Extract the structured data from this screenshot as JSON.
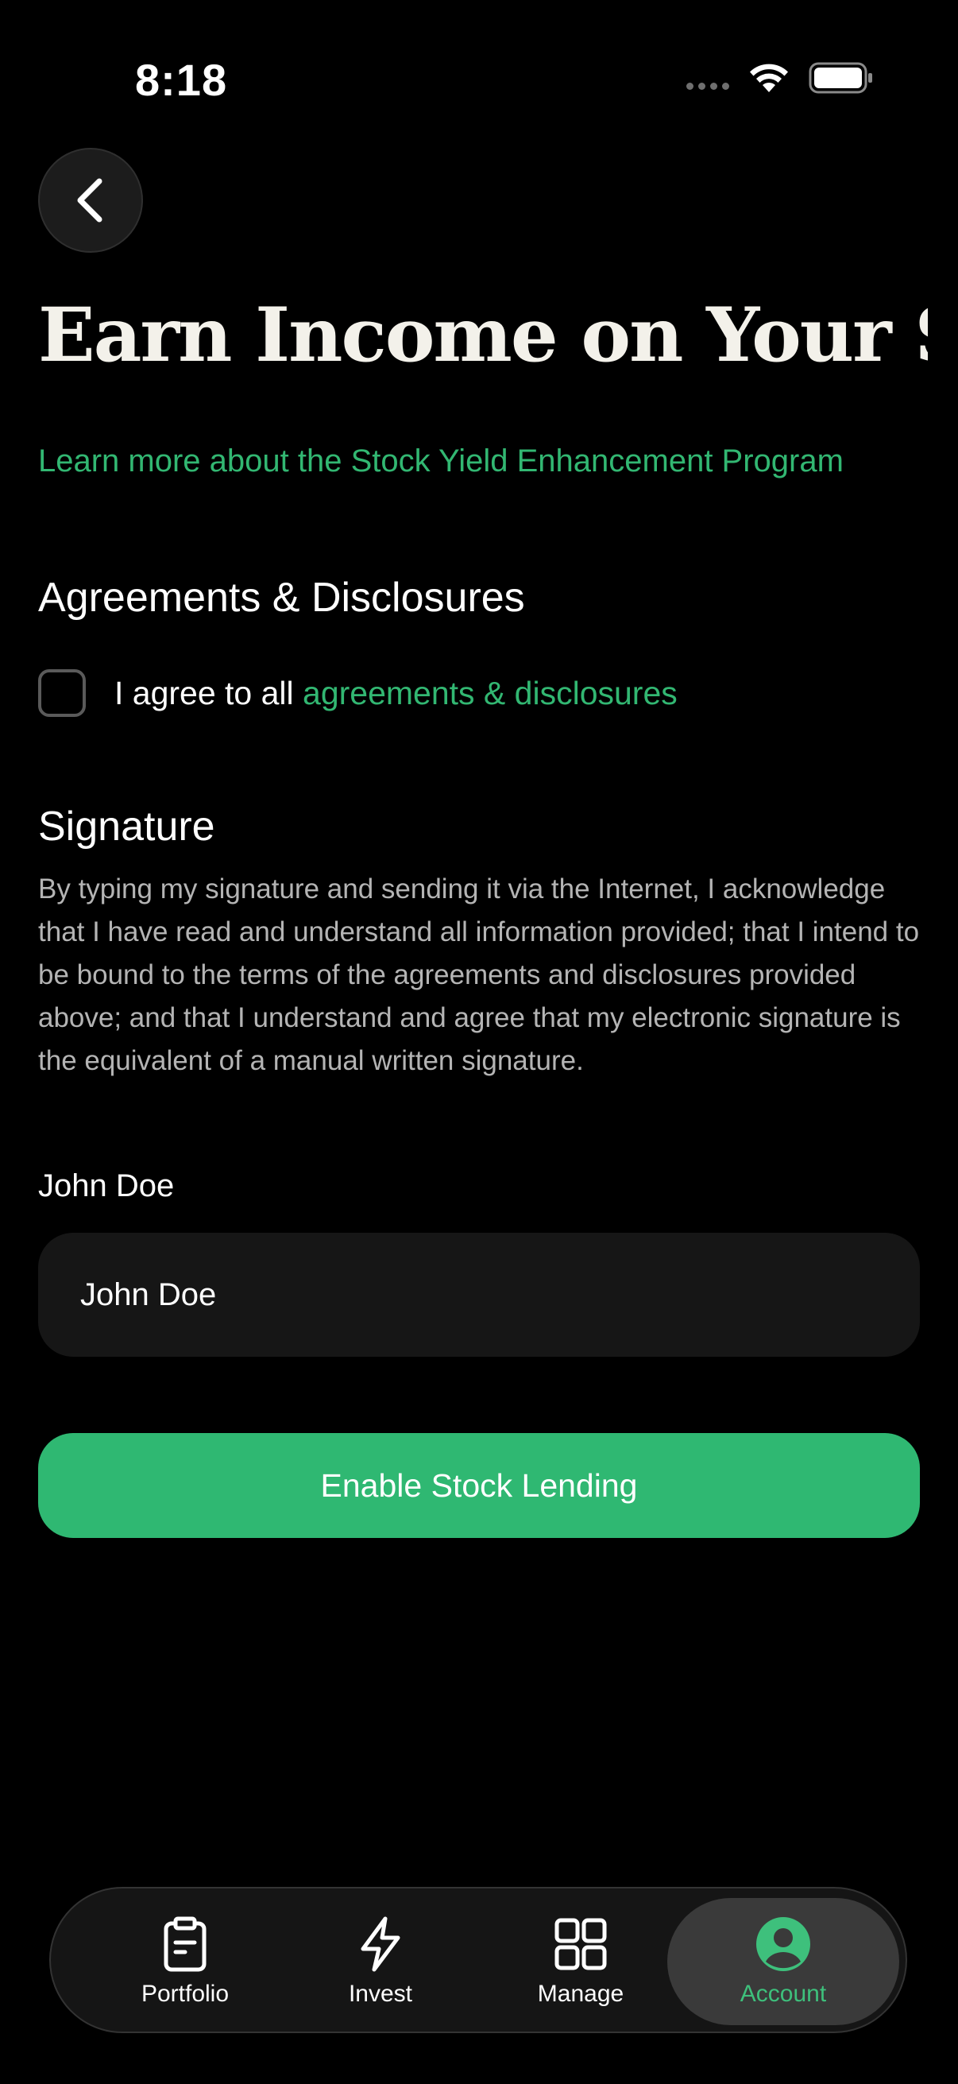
{
  "status_bar": {
    "time": "8:18"
  },
  "header": {
    "back_icon": "chevron-left-icon",
    "title": "Earn Income on Your S..."
  },
  "learn_more": {
    "text": "Learn more about the Stock Yield Enhancement Program"
  },
  "agreements": {
    "heading": "Agreements & Disclosures",
    "checked": false,
    "prefix": "I agree to all ",
    "link": "agreements & disclosures"
  },
  "signature": {
    "heading": "Signature",
    "body": "By typing my signature and sending it via the Internet, I acknowledge that I have read and understand all information provided; that I intend to be bound to the terms of the agreements and disclosures provided above; and that I understand and agree that my electronic signature is the equivalent of a manual written signature.",
    "name_label": "John Doe",
    "input_value": "John Doe"
  },
  "primary_action": {
    "label": "Enable Stock Lending"
  },
  "tab_bar": {
    "items": [
      {
        "label": "Portfolio",
        "icon": "clipboard-icon",
        "active": false
      },
      {
        "label": "Invest",
        "icon": "lightning-icon",
        "active": false
      },
      {
        "label": "Manage",
        "icon": "grid-icon",
        "active": false
      },
      {
        "label": "Account",
        "icon": "user-circle-icon",
        "active": true
      }
    ]
  },
  "colors": {
    "background": "#000000",
    "accent_green": "#2fb872",
    "link_green": "#32b772",
    "title_text": "#f3f1ea",
    "body_text": "#b4b4b4",
    "input_background": "#161616"
  }
}
